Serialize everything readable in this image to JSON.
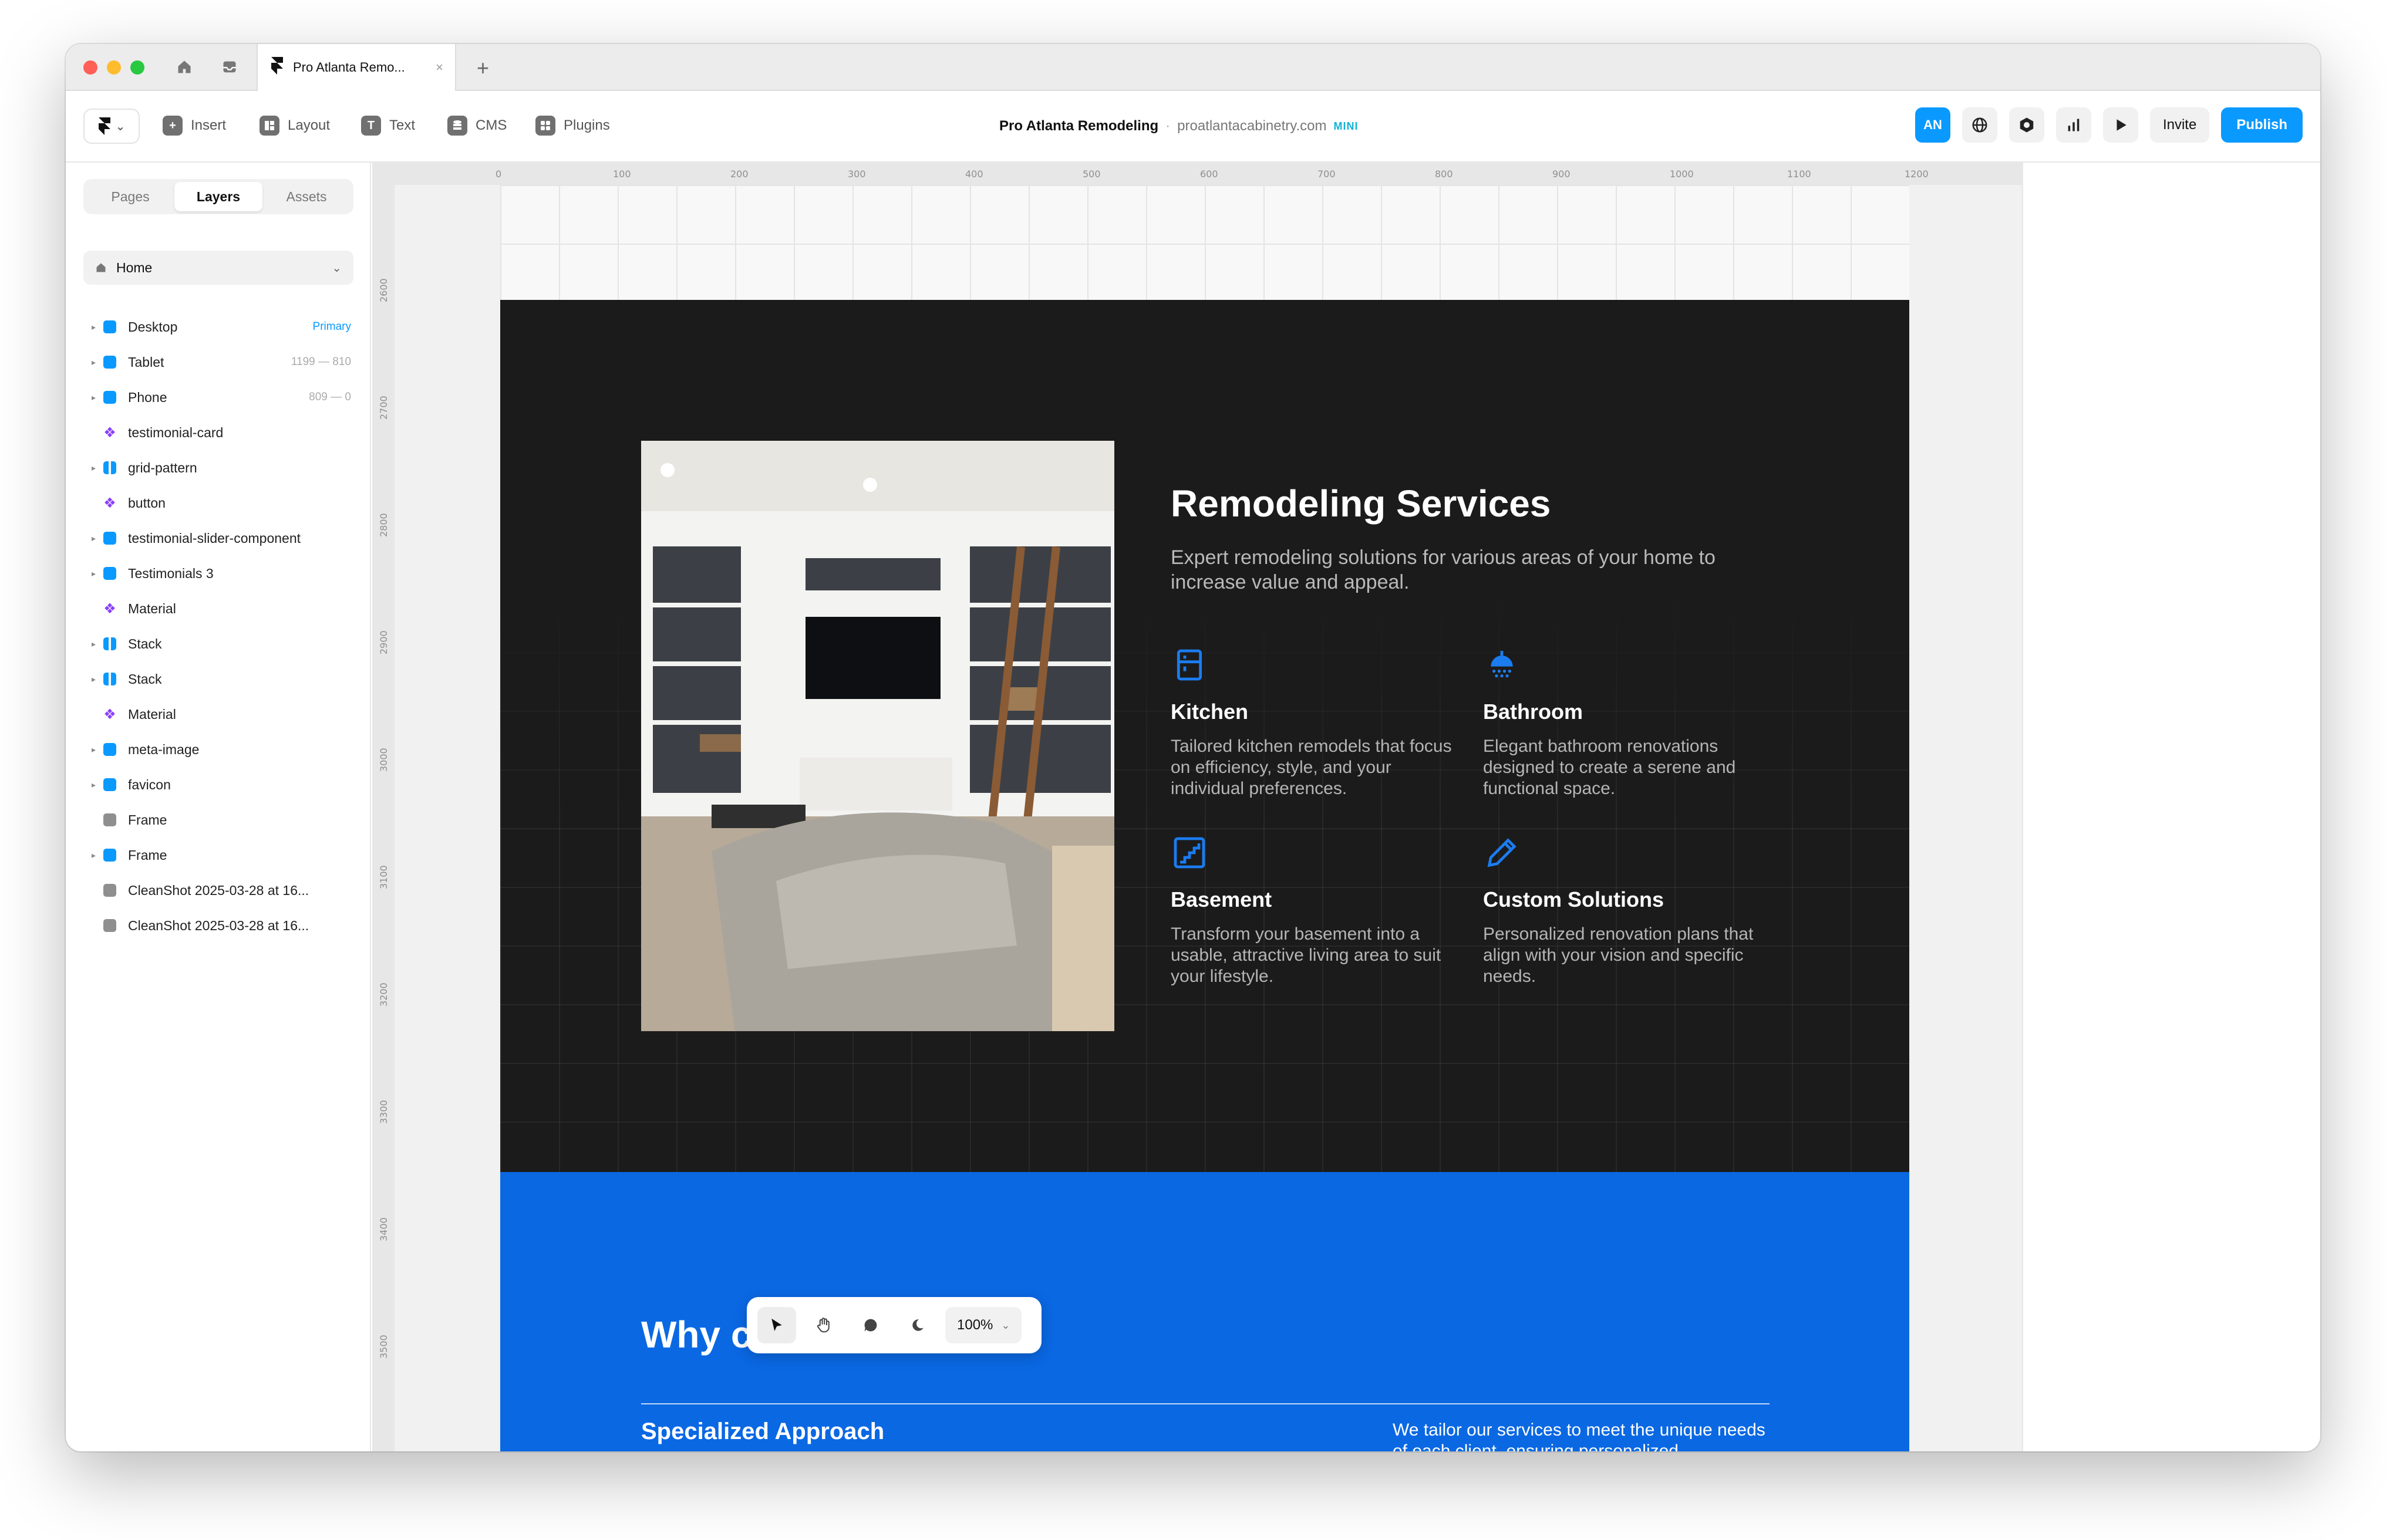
{
  "browser": {
    "tab_title": "Pro Atlanta Remo...",
    "tab_close": "×",
    "new_tab": "+"
  },
  "toolbar": {
    "logo_chevron": "⌄",
    "insert": "Insert",
    "layout": "Layout",
    "text": "Text",
    "cms": "CMS",
    "plugins": "Plugins",
    "project_name": "Pro Atlanta Remodeling",
    "project_sep": "·",
    "project_domain": "proatlantacabinetry.com",
    "project_badge": "MINI",
    "avatar_initials": "AN",
    "invite": "Invite",
    "publish": "Publish"
  },
  "sidebar": {
    "tabs": [
      "Pages",
      "Layers",
      "Assets"
    ],
    "active_tab": "Layers",
    "page_select": "Home",
    "layers": [
      {
        "name": "Desktop",
        "meta": "Primary",
        "icon": "blue",
        "arrow": true,
        "primary": true
      },
      {
        "name": "Tablet",
        "meta": "1199 — 810",
        "icon": "blue",
        "arrow": true
      },
      {
        "name": "Phone",
        "meta": "809 — 0",
        "icon": "blue",
        "arrow": true
      },
      {
        "name": "testimonial-card",
        "meta": "",
        "icon": "purple",
        "arrow": false
      },
      {
        "name": "grid-pattern",
        "meta": "",
        "icon": "bluecol",
        "arrow": true
      },
      {
        "name": "button",
        "meta": "",
        "icon": "purple",
        "arrow": false
      },
      {
        "name": "testimonial-slider-component",
        "meta": "",
        "icon": "blue",
        "arrow": true
      },
      {
        "name": "Testimonials 3",
        "meta": "",
        "icon": "blue",
        "arrow": true
      },
      {
        "name": "Material",
        "meta": "",
        "icon": "purple",
        "arrow": false
      },
      {
        "name": "Stack",
        "meta": "",
        "icon": "bluecol",
        "arrow": true
      },
      {
        "name": "Stack",
        "meta": "",
        "icon": "bluecol",
        "arrow": true
      },
      {
        "name": "Material",
        "meta": "",
        "icon": "purple",
        "arrow": false
      },
      {
        "name": "meta-image",
        "meta": "",
        "icon": "blue",
        "arrow": true
      },
      {
        "name": "favicon",
        "meta": "",
        "icon": "blue",
        "arrow": true
      },
      {
        "name": "Frame",
        "meta": "",
        "icon": "gray",
        "arrow": false
      },
      {
        "name": "Frame",
        "meta": "",
        "icon": "blue",
        "arrow": true
      },
      {
        "name": "CleanShot 2025-03-28 at 16...",
        "meta": "",
        "icon": "gray",
        "arrow": false
      },
      {
        "name": "CleanShot 2025-03-28 at 16...",
        "meta": "",
        "icon": "gray",
        "arrow": false
      }
    ]
  },
  "ruler": {
    "top": [
      "0",
      "100",
      "200",
      "300",
      "400",
      "500",
      "600",
      "700",
      "800",
      "900",
      "1000",
      "1100",
      "1200"
    ],
    "left": [
      "2600",
      "2700",
      "2800",
      "2900",
      "3000",
      "3100",
      "3200",
      "3300",
      "3400",
      "3500"
    ]
  },
  "services": {
    "title": "Remodeling Services",
    "subtitle": "Expert remodeling solutions for various areas of your home to increase value and appeal.",
    "items": [
      {
        "name": "Kitchen",
        "desc": "Tailored kitchen remodels that focus on efficiency, style, and your individual preferences.",
        "icon": "kitchen-icon"
      },
      {
        "name": "Bathroom",
        "desc": "Elegant bathroom renovations designed to create a serene and functional space.",
        "icon": "shower-icon"
      },
      {
        "name": "Basement",
        "desc": "Transform your basement into a usable, attractive living area to suit your lifestyle.",
        "icon": "stairs-icon"
      },
      {
        "name": "Custom Solutions",
        "desc": "Personalized renovation plans that align with your vision and specific needs.",
        "icon": "pencil-icon"
      }
    ]
  },
  "why": {
    "title": "Why choose us?",
    "heading": "Specialized Approach",
    "desc": "We tailor our services to meet the unique needs of each client, ensuring personalized"
  },
  "floatbar": {
    "zoom": "100%",
    "chev": "⌄"
  },
  "colors": {
    "accent": "#0a99ff",
    "brand_blue": "#0a68e3",
    "dark_bg": "#1b1b1b",
    "icon_blue": "#1b7cf0"
  }
}
